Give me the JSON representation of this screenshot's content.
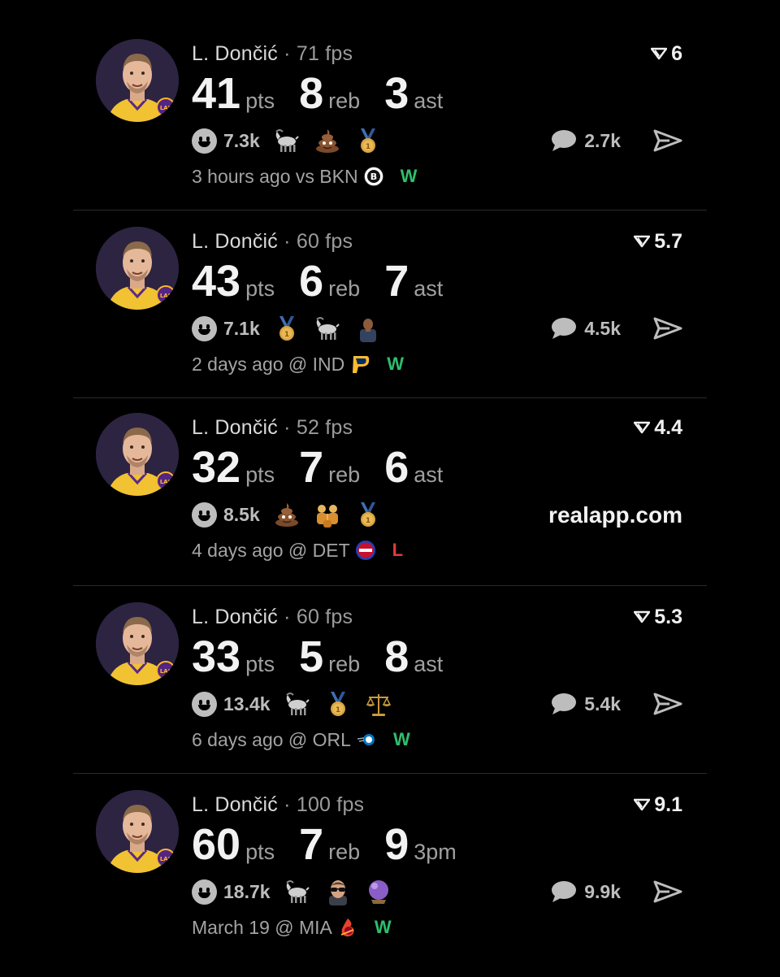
{
  "theme": {
    "background": "#000000",
    "win": "#2dbf6c",
    "loss": "#e43a3a",
    "avatar_bg": "#2d2442"
  },
  "posts": [
    {
      "name": "L. Dončić",
      "fps": "71 fps",
      "rating": "6",
      "s1": "41",
      "u1": "pts",
      "s2": "8",
      "u2": "reb",
      "s3": "3",
      "u3": "ast",
      "reactions": "7.3k",
      "emojis": [
        "goat",
        "poop",
        "medal"
      ],
      "comments": "2.7k",
      "meta": "3 hours ago vs BKN",
      "team_icon": "nets-logo",
      "result": "W"
    },
    {
      "name": "L. Dončić",
      "fps": "60 fps",
      "rating": "5.7",
      "s1": "43",
      "u1": "pts",
      "s2": "6",
      "u2": "reb",
      "s3": "7",
      "u3": "ast",
      "reactions": "7.1k",
      "emojis": [
        "medal",
        "goat",
        "player"
      ],
      "comments": "4.5k",
      "meta": "2 days ago @ IND",
      "team_icon": "pacers-logo",
      "result": "W"
    },
    {
      "name": "L. Dončić",
      "fps": "52 fps",
      "rating": "4.4",
      "s1": "32",
      "u1": "pts",
      "s2": "7",
      "u2": "reb",
      "s3": "6",
      "u3": "ast",
      "reactions": "8.5k",
      "emojis": [
        "poop",
        "family",
        "medal"
      ],
      "promo": "realapp.com",
      "meta": "4 days ago @ DET",
      "team_icon": "pistons-logo",
      "result": "L"
    },
    {
      "name": "L. Dončić",
      "fps": "60 fps",
      "rating": "5.3",
      "s1": "33",
      "u1": "pts",
      "s2": "5",
      "u2": "reb",
      "s3": "8",
      "u3": "ast",
      "reactions": "13.4k",
      "emojis": [
        "goat",
        "medal",
        "scales"
      ],
      "comments": "5.4k",
      "meta": "6 days ago @ ORL",
      "team_icon": "magic-logo",
      "result": "W"
    },
    {
      "name": "L. Dončić",
      "fps": "100 fps",
      "rating": "9.1",
      "s1": "60",
      "u1": "pts",
      "s2": "7",
      "u2": "reb",
      "s3": "9",
      "u3": "3pm",
      "reactions": "18.7k",
      "emojis": [
        "goat",
        "sunglasses-face",
        "crystal-ball"
      ],
      "comments": "9.9k",
      "meta": "March 19 @ MIA",
      "team_icon": "heat-logo",
      "result": "W"
    }
  ]
}
